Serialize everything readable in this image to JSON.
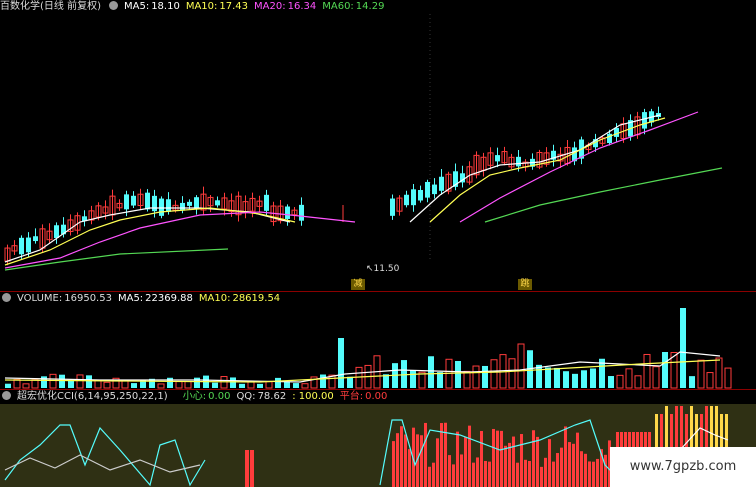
{
  "price_panel": {
    "stock_name": "百数化学",
    "period": "(日线 前复权)",
    "ma5_label": "MA5:",
    "ma5_value": "18.10",
    "ma10_label": "MA10:",
    "ma10_value": "17.43",
    "ma20_label": "MA20:",
    "ma20_value": "16.34",
    "ma60_label": "MA60:",
    "ma60_value": "14.29",
    "low_price_note": "11.50",
    "marker_reduce": "减",
    "marker_jump": "跳"
  },
  "volume_panel": {
    "vol_label": "VOLUME:",
    "vol_value": "16950.53",
    "ma5_label": "MA5:",
    "ma5_value": "22369.88",
    "ma10_label": "MA10:",
    "ma10_value": "28619.54"
  },
  "indicator_panel": {
    "name": "超宏优化CCI(6,14,95,250,22,1)",
    "xx_label": "小心:",
    "xx_value": "0.00",
    "qq_label": "QQ:",
    "qq_value": "78.62",
    "third_value": ": 100.00",
    "pt_label": "平台:",
    "pt_value": "0.00"
  },
  "watermark": "www.7gpzb.com",
  "colors": {
    "up": "#ff3c3c",
    "down": "#54fcfc",
    "ma5": "#ffffff",
    "ma10": "#ffff54",
    "ma20": "#ff54ff",
    "ma60": "#54d854",
    "bg_ind": "#2f3014"
  }
}
